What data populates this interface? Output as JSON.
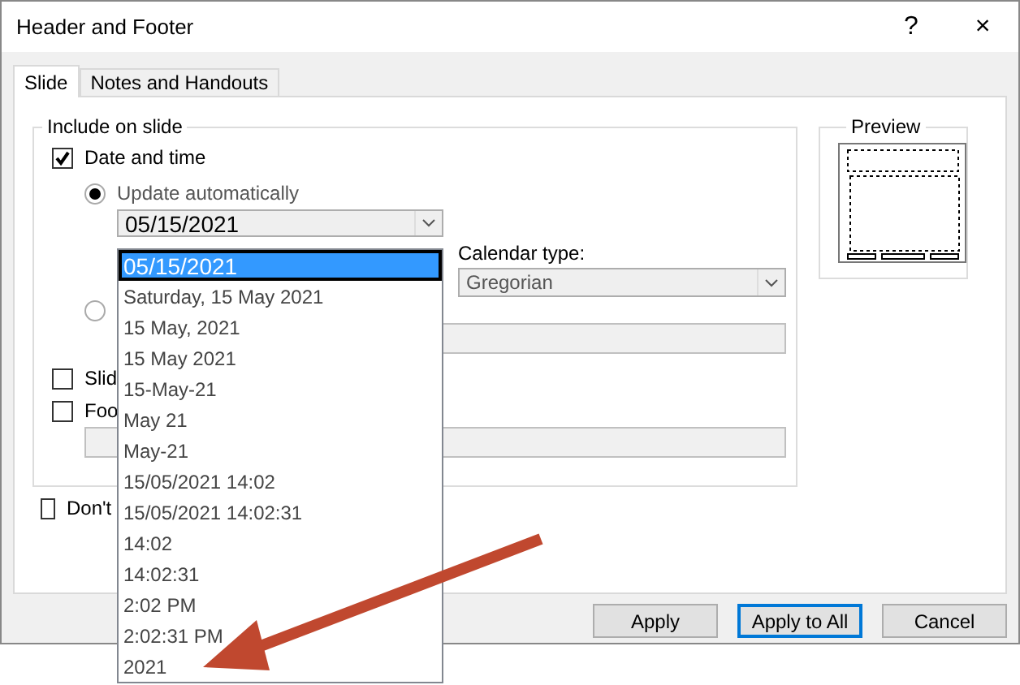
{
  "window": {
    "title": "Header and Footer",
    "help_button": "?",
    "close_button": "×"
  },
  "tabs": [
    {
      "label": "Slide",
      "selected": true
    },
    {
      "label": "Notes and Handouts",
      "selected": false
    }
  ],
  "include_group": {
    "legend": "Include on slide",
    "date_and_time": {
      "label": "Date and time",
      "checked": true
    },
    "update_automatically": {
      "label": "Update automatically",
      "selected": true
    },
    "date_format": {
      "value": "05/15/2021",
      "options": [
        {
          "label": "05/15/2021",
          "selected": true
        },
        {
          "label": "Saturday, 15 May 2021",
          "selected": false
        },
        {
          "label": "15 May, 2021",
          "selected": false
        },
        {
          "label": "15 May 2021",
          "selected": false
        },
        {
          "label": "15-May-21",
          "selected": false
        },
        {
          "label": "May 21",
          "selected": false
        },
        {
          "label": "May-21",
          "selected": false
        },
        {
          "label": "15/05/2021 14:02",
          "selected": false
        },
        {
          "label": "15/05/2021 14:02:31",
          "selected": false
        },
        {
          "label": "14:02",
          "selected": false
        },
        {
          "label": "14:02:31",
          "selected": false
        },
        {
          "label": "2:02 PM",
          "selected": false
        },
        {
          "label": "2:02:31 PM",
          "selected": false
        },
        {
          "label": "2021",
          "selected": false
        }
      ]
    },
    "calendar_type": {
      "label": "Calendar type:",
      "value": "Gregorian"
    },
    "fixed": {
      "selected": false
    },
    "slide_number": {
      "label": "Slid",
      "checked": false
    },
    "footer": {
      "label": "Foo",
      "checked": false
    }
  },
  "dont_show": {
    "label": "Don't",
    "checked": false
  },
  "preview": {
    "legend": "Preview"
  },
  "buttons": [
    {
      "label": "Apply",
      "default": false
    },
    {
      "label": "Apply to All",
      "default": true
    },
    {
      "label": "Cancel",
      "default": false
    }
  ]
}
